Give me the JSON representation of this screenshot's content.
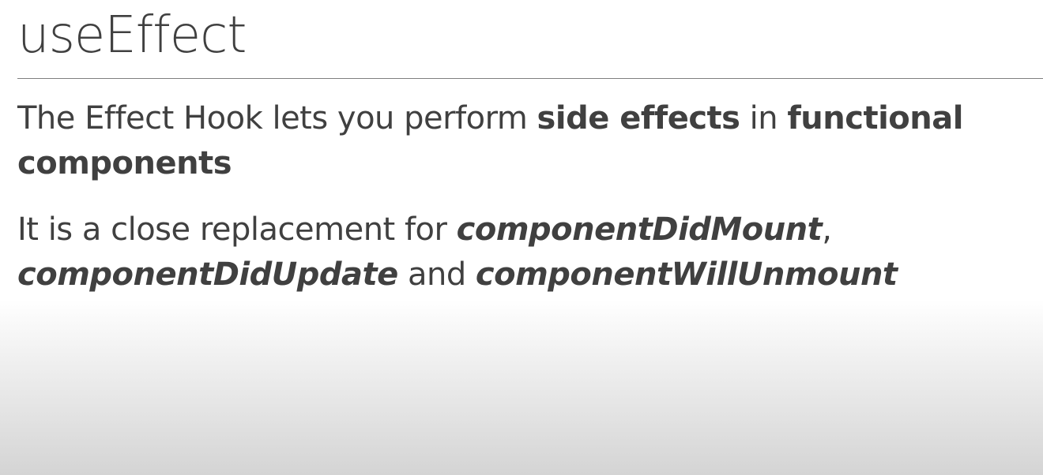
{
  "slide": {
    "title": "useEffect",
    "paragraph1": {
      "t1": "The Effect Hook lets you perform ",
      "b1": "side effects",
      "t2": " in ",
      "b2": "functional components"
    },
    "paragraph2": {
      "t1": "It is a close replacement for ",
      "bi1": "componentDidMount",
      "t2": ", ",
      "bi2": "componentDidUpdate",
      "t3": " and ",
      "bi3": "componentWillUnmount"
    }
  }
}
